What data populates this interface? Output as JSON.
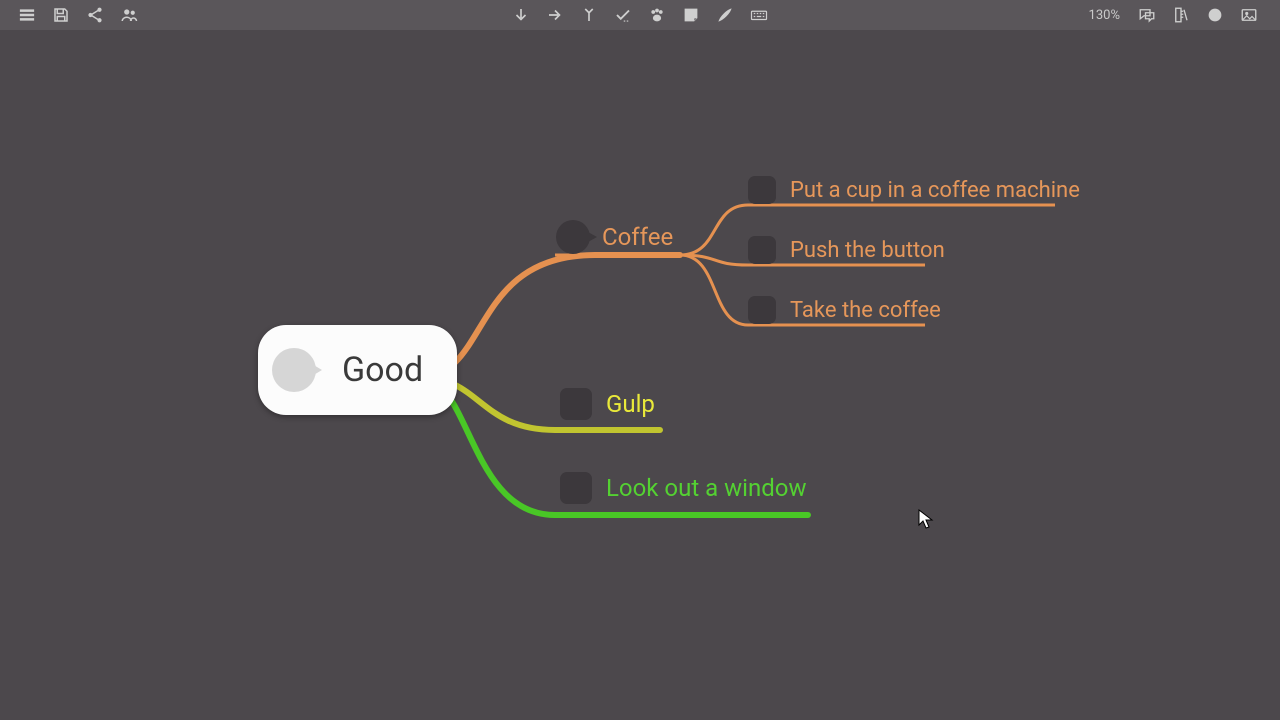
{
  "toolbar": {
    "zoom": "130%",
    "icons_left": [
      "bars",
      "save",
      "share",
      "people"
    ],
    "icons_center": [
      "down",
      "right",
      "split",
      "check",
      "paw",
      "note",
      "brush",
      "keyboard"
    ],
    "icons_right": [
      "chat",
      "ruler",
      "circle",
      "image"
    ]
  },
  "map": {
    "root": {
      "label": "Good"
    },
    "branches": [
      {
        "label": "Coffee",
        "color": "#e59150",
        "children": [
          {
            "label": "Put a cup in a coffee machine",
            "color": "#e59150"
          },
          {
            "label": "Push the button",
            "color": "#e59150"
          },
          {
            "label": "Take the coffee",
            "color": "#e59150"
          }
        ]
      },
      {
        "label": "Gulp",
        "color": "#d9d433",
        "children": []
      },
      {
        "label": "Look out a window",
        "color": "#49c726",
        "children": []
      }
    ]
  }
}
